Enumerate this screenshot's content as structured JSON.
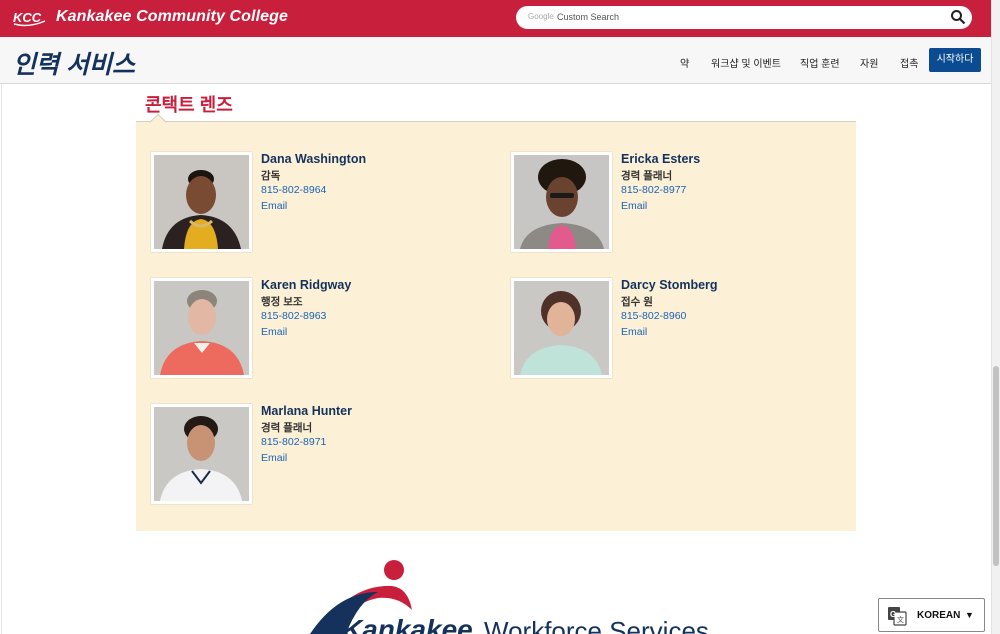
{
  "header": {
    "logo_text": "KCC",
    "college_name": "Kankakee Community College",
    "search": {
      "google_label": "Google",
      "placeholder": "Custom Search"
    }
  },
  "nav": {
    "section_title": "인력 서비스",
    "items": [
      {
        "label": "약"
      },
      {
        "label": "워크샵 및 이벤트"
      },
      {
        "label": "직업 훈련"
      },
      {
        "label": "자원"
      },
      {
        "label": "접촉"
      }
    ],
    "cta_label": "시작하다"
  },
  "content": {
    "title": "콘택트 렌즈",
    "staff": [
      {
        "name": "Dana Washington",
        "role": "감독",
        "phone": "815-802-8964",
        "email": "Email"
      },
      {
        "name": "Ericka Esters",
        "role": "경력 플래너",
        "phone": "815-802-8977",
        "email": "Email"
      },
      {
        "name": "Karen Ridgway",
        "role": "행정 보조",
        "phone": "815-802-8963",
        "email": "Email"
      },
      {
        "name": "Darcy Stomberg",
        "role": "접수 원",
        "phone": "815-802-8960",
        "email": "Email"
      },
      {
        "name": "Marlana Hunter",
        "role": "경력 플래너",
        "phone": "815-802-8971",
        "email": "Email"
      }
    ]
  },
  "footer": {
    "logo_text_bold": "Kankakee",
    "logo_text_light": "Workforce Services"
  },
  "language": {
    "label": "KOREAN"
  },
  "colors": {
    "brand_red": "#c8203c",
    "navy": "#14325c",
    "link_blue": "#1a63b8",
    "panel_bg": "#fcf0d6",
    "cta_blue": "#0b4b91"
  }
}
